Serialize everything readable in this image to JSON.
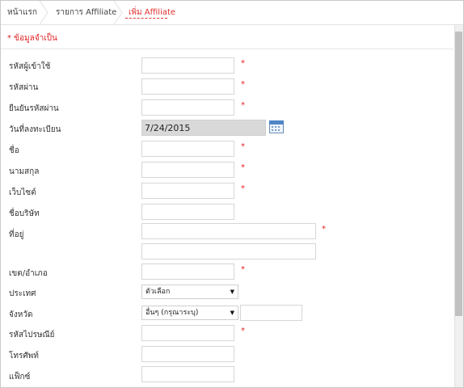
{
  "breadcrumb": {
    "home": "หน้าแรก",
    "list": "รายการ Affiliate",
    "current": "เพิ่ม Affiliate"
  },
  "form": {
    "required_note": "* ข้อมูลจำเป็น",
    "required_mark": "*",
    "fields": {
      "username": {
        "label": "รหัสผู้เข้าใช้",
        "value": ""
      },
      "password": {
        "label": "รหัสผ่าน",
        "value": ""
      },
      "confirm_password": {
        "label": "ยืนยันรหัสผ่าน",
        "value": ""
      },
      "register_date": {
        "label": "วันที่ลงทะเบียน",
        "value": "7/24/2015",
        "icon": "calendar-icon"
      },
      "first_name": {
        "label": "ชื่อ",
        "value": ""
      },
      "last_name": {
        "label": "นามสกุล",
        "value": ""
      },
      "website": {
        "label": "เว็บไซต์",
        "value": ""
      },
      "company": {
        "label": "ชื่อบริษัท",
        "value": ""
      },
      "address": {
        "label": "ที่อยู่",
        "value": "",
        "value2": ""
      },
      "district": {
        "label": "เขต/อำเภอ",
        "value": ""
      },
      "country": {
        "label": "ประเทศ",
        "selected": "ตัวเลือก"
      },
      "province": {
        "label": "จังหวัด",
        "selected": "อื่นๆ (กรุณาระบุ)",
        "other_value": ""
      },
      "postcode": {
        "label": "รหัสไปรษณีย์",
        "value": ""
      },
      "phone": {
        "label": "โทรศัพท์",
        "value": ""
      },
      "fax": {
        "label": "แฟ็กซ์",
        "value": ""
      }
    }
  },
  "colors": {
    "accent_red": "#e03030",
    "disabled_field": "#d9d9d9",
    "border": "#d6d6d6"
  }
}
